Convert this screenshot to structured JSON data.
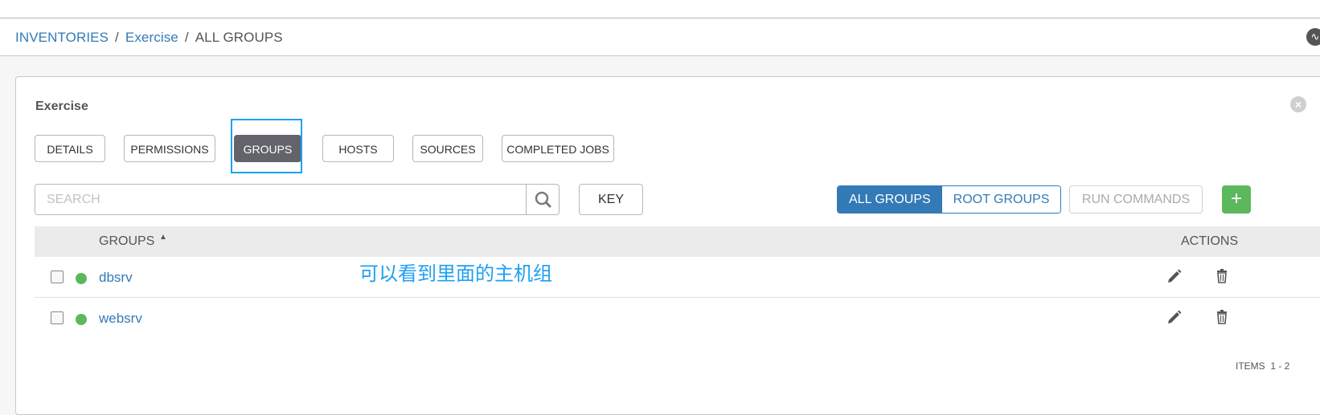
{
  "breadcrumb": {
    "items": [
      {
        "label": "INVENTORIES"
      },
      {
        "label": "Exercise"
      }
    ],
    "separator": "/",
    "current": "ALL GROUPS"
  },
  "panel": {
    "title": "Exercise",
    "tabs": [
      {
        "label": "DETAILS",
        "active": false
      },
      {
        "label": "PERMISSIONS",
        "active": false
      },
      {
        "label": "GROUPS",
        "active": true
      },
      {
        "label": "HOSTS",
        "active": false
      },
      {
        "label": "SOURCES",
        "active": false
      },
      {
        "label": "COMPLETED JOBS",
        "active": false
      }
    ]
  },
  "toolbar": {
    "search_placeholder": "SEARCH",
    "key_label": "KEY",
    "toggle": {
      "all_label": "ALL GROUPS",
      "root_label": "ROOT GROUPS",
      "selected": "ALL GROUPS"
    },
    "run_commands_label": "RUN COMMANDS",
    "add_label": "+"
  },
  "table": {
    "headers": {
      "groups": "GROUPS",
      "actions": "ACTIONS"
    },
    "sort": "ascending",
    "rows": [
      {
        "name": "dbsrv",
        "status": "ok"
      },
      {
        "name": "websrv",
        "status": "ok"
      }
    ]
  },
  "annotation": "可以看到里面的主机组",
  "footer": {
    "items_label": "ITEMS",
    "items_range": "1 - 2"
  },
  "colors": {
    "link": "#337ab7",
    "active_tab": "#63646b",
    "success": "#5cb85c",
    "highlight": "#1ea0f2"
  },
  "icons": [
    "search-icon",
    "close-icon",
    "activity-icon",
    "sort-asc-icon",
    "pencil-icon",
    "trash-icon"
  ]
}
